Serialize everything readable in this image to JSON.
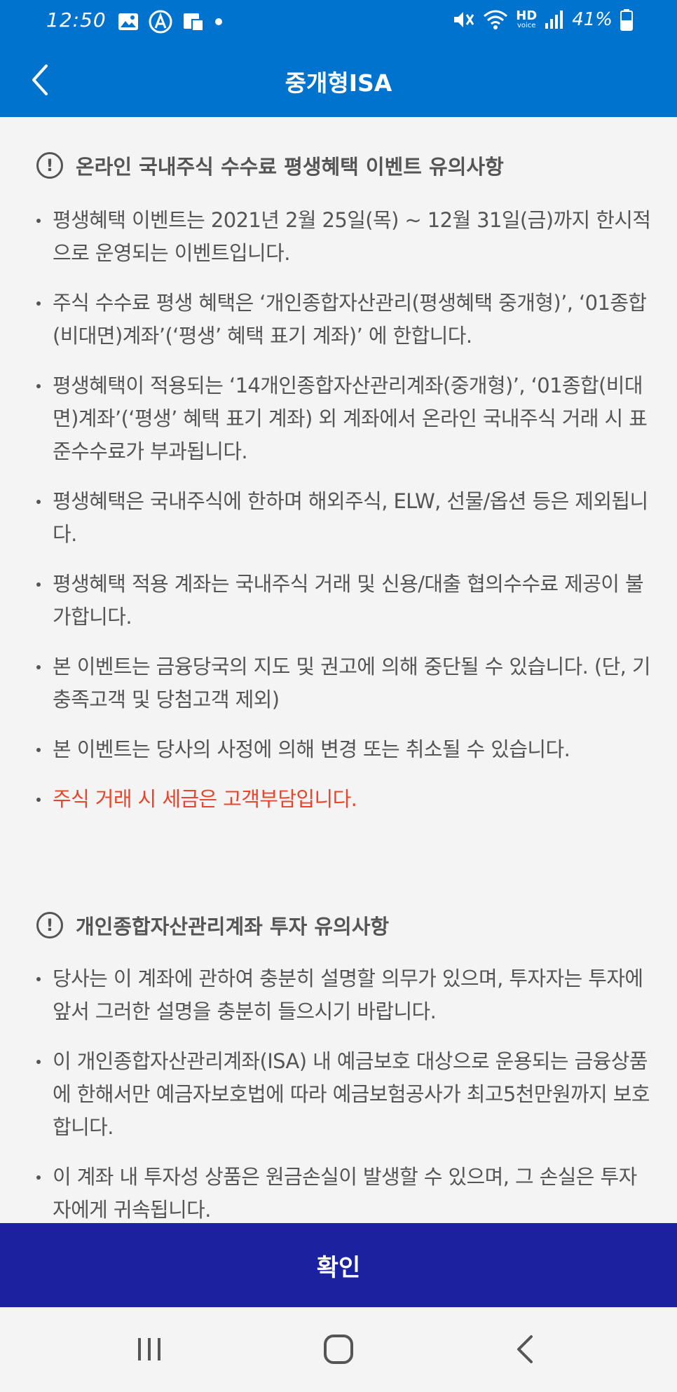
{
  "status_bar": {
    "time": "12:50",
    "network_label": "HD",
    "network_sublabel": "voice",
    "battery": "41%",
    "icons": [
      "image-icon",
      "a-circle-icon",
      "sim-icon",
      "dot-icon",
      "mute-icon",
      "wifi-icon",
      "signal-icon",
      "battery-icon"
    ]
  },
  "header": {
    "title": "중개형ISA",
    "back_icon": "chevron-left-icon"
  },
  "sections": [
    {
      "title": "온라인 국내주식 수수료 평생혜택 이벤트 유의사항",
      "icon": "alert-circle-icon",
      "items": [
        "평생혜택 이벤트는 2021년 2월 25일(목) ~ 12월 31일(금)까지 한시적으로 운영되는 이벤트입니다.",
        "주식 수수료 평생 혜택은 ‘개인종합자산관리(평생혜택 중개형)’, ‘01종합(비대면)계좌’(‘평생’ 혜택 표기 계좌)’ 에 한합니다.",
        "평생혜택이 적용되는 ‘14개인종합자산관리계좌(중개형)’, ‘01종합(비대면)계좌’(‘평생’ 혜택 표기 계좌) 외 계좌에서 온라인 국내주식 거래 시 표준수수료가 부과됩니다.",
        "평생혜택은 국내주식에 한하며 해외주식, ELW, 선물/옵션 등은 제외됩니다.",
        "평생혜택 적용 계좌는 국내주식 거래 및 신용/대출 협의수수료 제공이 불가합니다.",
        "본 이벤트는 금융당국의 지도 및 권고에 의해 중단될 수 있습니다. (단, 기 충족고객 및 당첨고객 제외)",
        "본 이벤트는 당사의 사정에 의해 변경 또는 취소될 수 있습니다.",
        "주식 거래 시 세금은 고객부담입니다."
      ],
      "highlight_color": "#e8452c"
    },
    {
      "title": "개인종합자산관리계좌 투자 유의사항",
      "icon": "alert-circle-icon",
      "items": [
        "당사는 이 계좌에 관하여 충분히 설명할 의무가 있으며, 투자자는 투자에 앞서 그러한 설명을 충분히 들으시기 바랍니다.",
        "이 개인종합자산관리계좌(ISA) 내 예금보호 대상으로 운용되는 금융상품에 한해서만 예금자보호법에 따라 예금보험공사가 최고5천만원까지 보호합니다.",
        "이 계좌 내 투자성 상품은 원금손실이 발생할 수 있으며, 그 손실은 투자자에게 귀속됩니다."
      ]
    }
  ],
  "confirm_label": "확인",
  "nav": {
    "recents_icon": "recents-icon",
    "home_icon": "home-icon",
    "back_icon": "back-icon"
  },
  "colors": {
    "header_bg": "#0073cf",
    "button_bg": "#1a22a0",
    "text": "#555555",
    "warning": "#e8452c"
  }
}
